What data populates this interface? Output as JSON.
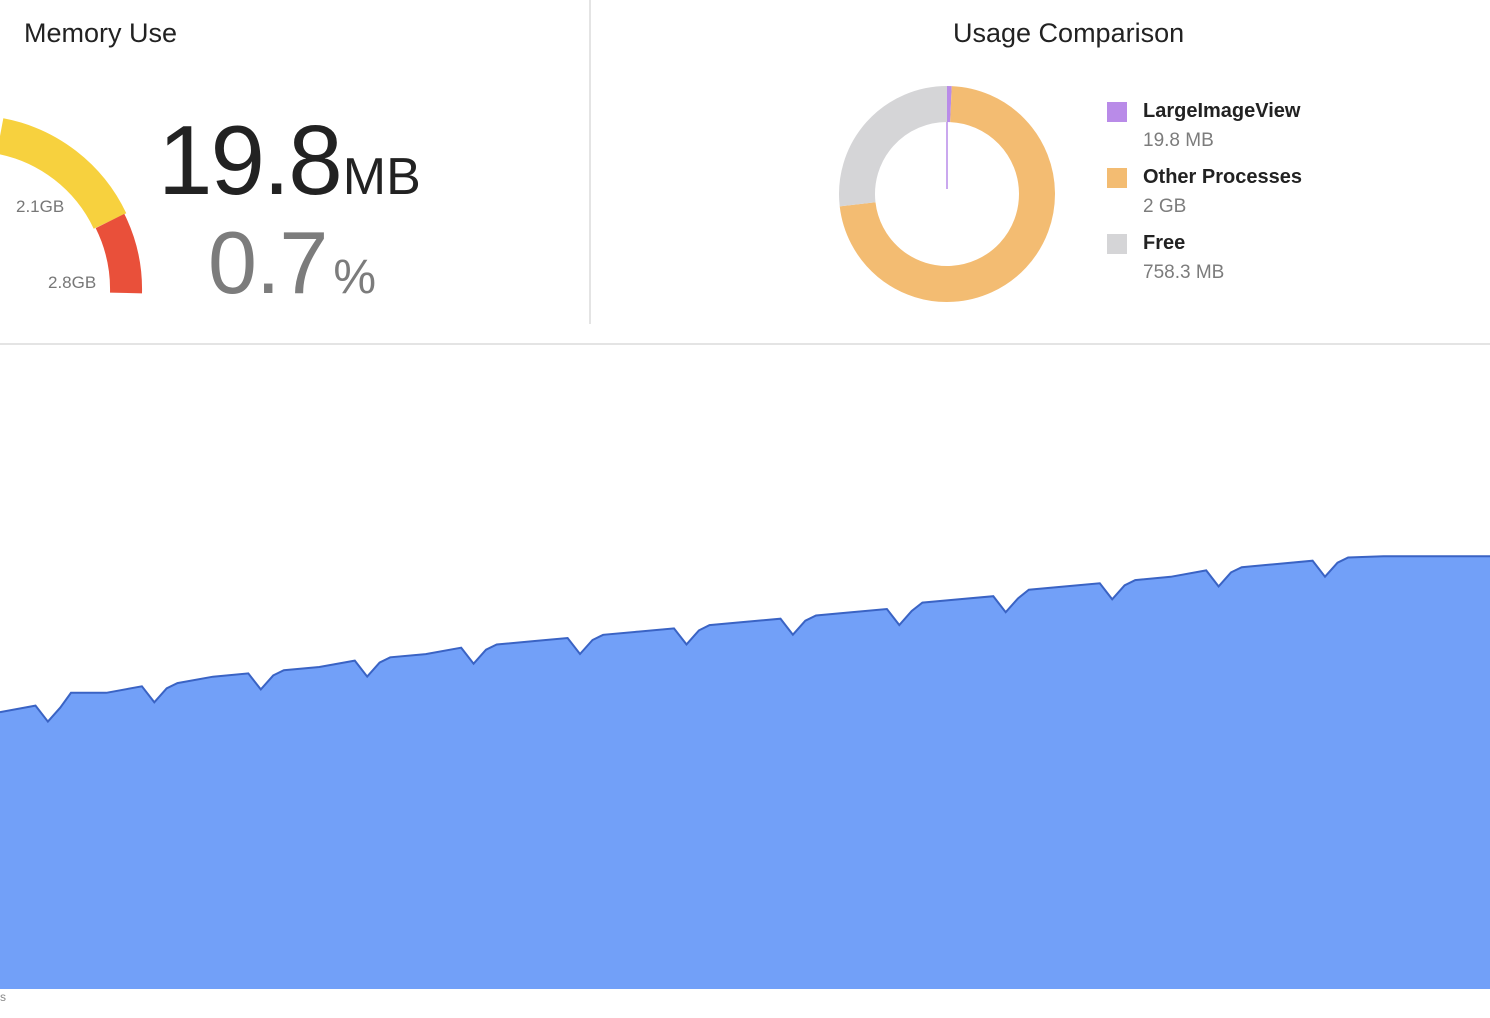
{
  "memory_use": {
    "title": "Memory Use",
    "value": "19.8",
    "unit": "MB",
    "percent": "0.7",
    "percent_unit": "%",
    "gauge": {
      "labels": [
        "2.1GB",
        "2.8GB"
      ],
      "segment_colors": {
        "normal": "#f7d13e",
        "high": "#e9503a"
      }
    }
  },
  "usage_comparison": {
    "title": "Usage Comparison",
    "legend": [
      {
        "name": "LargeImageView",
        "value": "19.8 MB",
        "color": "#b98be8"
      },
      {
        "name": "Other Processes",
        "value": "2 GB",
        "color": "#f3bc72"
      },
      {
        "name": "Free",
        "value": "758.3 MB",
        "color": "#d5d5d7"
      }
    ]
  },
  "chart_data": [
    {
      "type": "pie",
      "labels": [
        "LargeImageView",
        "Other Processes",
        "Free"
      ],
      "values": [
        19.8,
        2048,
        758.3
      ],
      "units": "MB",
      "donut": true
    },
    {
      "type": "area",
      "series": [
        {
          "values": [
            4.3,
            4.4,
            4.6,
            4.6,
            4.7,
            4.75,
            4.85,
            4.9,
            4.95,
            5.0,
            5.1,
            5.15,
            5.2,
            5.3,
            5.35,
            5.4,
            5.45,
            5.5,
            5.55,
            5.6,
            5.65,
            5.7,
            5.75,
            5.8,
            5.85,
            5.9,
            6.0,
            6.05,
            6.1,
            6.2,
            6.25,
            6.3,
            6.35,
            6.4,
            6.5,
            6.55,
            6.6,
            6.65,
            6.7,
            6.72,
            6.72,
            6.72,
            6.72
          ],
          "color": "#72a0f8"
        }
      ],
      "ylim": [
        0,
        10
      ],
      "grid": false,
      "axis_tick": "s"
    }
  ]
}
